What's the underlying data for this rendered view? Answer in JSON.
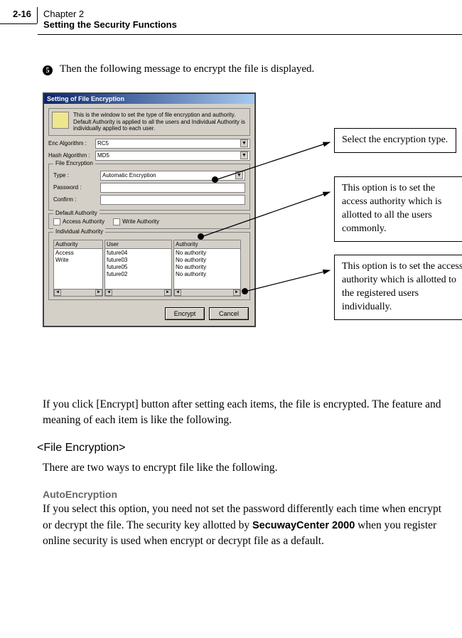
{
  "header": {
    "page_num": "2-16",
    "chapter": "Chapter 2",
    "title": "Setting the Security Functions"
  },
  "step": {
    "num": "❺",
    "text": "Then the following message to encrypt the file is displayed."
  },
  "dialog": {
    "title": "Setting of File Encryption",
    "info": "This is the window to set the type of file encryption and authority. Default Authority is applied to all the users and Individual Authority is individually applied to each user.",
    "labels": {
      "enc_alg": "Enc Algorithm :",
      "hash_alg": "Hash Algorithm :",
      "file_enc": "File Encryption",
      "type": "Type :",
      "password": "Password :",
      "confirm": "Confirm :",
      "default_auth": "Default Authority",
      "access_auth": "Access Authority",
      "write_auth": "Write Authority",
      "individual_auth": "Individual Authority",
      "col_authority": "Authority",
      "col_user": "User",
      "col_authority2": "Authority"
    },
    "values": {
      "enc_alg": "RC5",
      "hash_alg": "MD5",
      "type": "Automatic Encryption"
    },
    "auth_col1": [
      "Access",
      "Write"
    ],
    "users": [
      "future04",
      "future03",
      "future05",
      "future02"
    ],
    "auth_values": [
      "No authority",
      "No authority",
      "No authority",
      "No authority"
    ],
    "buttons": {
      "encrypt": "Encrypt",
      "cancel": "Cancel"
    }
  },
  "callouts": {
    "c1": "Select the encryption type.",
    "c2": "This option is to set the access authority which is allotted to all the users commonly.",
    "c3": "This option is to set the access authority which is allotted to the registered users individually."
  },
  "body": {
    "after_fig": "If you click [Encrypt] button after setting each items, the file is encrypted. The feature and meaning of each item is like the following.",
    "section_head": "<File Encryption>",
    "section_intro": "There are two ways to encrypt file like the following.",
    "auto_head": "AutoEncryption",
    "auto_body_1": "If you select this option, you need not set the password differently each time when encrypt or decrypt the file. The security key allotted by ",
    "brand": "SecuwayCenter 2000",
    "auto_body_2": " when you register online security is used when encrypt or decrypt file as a default."
  }
}
